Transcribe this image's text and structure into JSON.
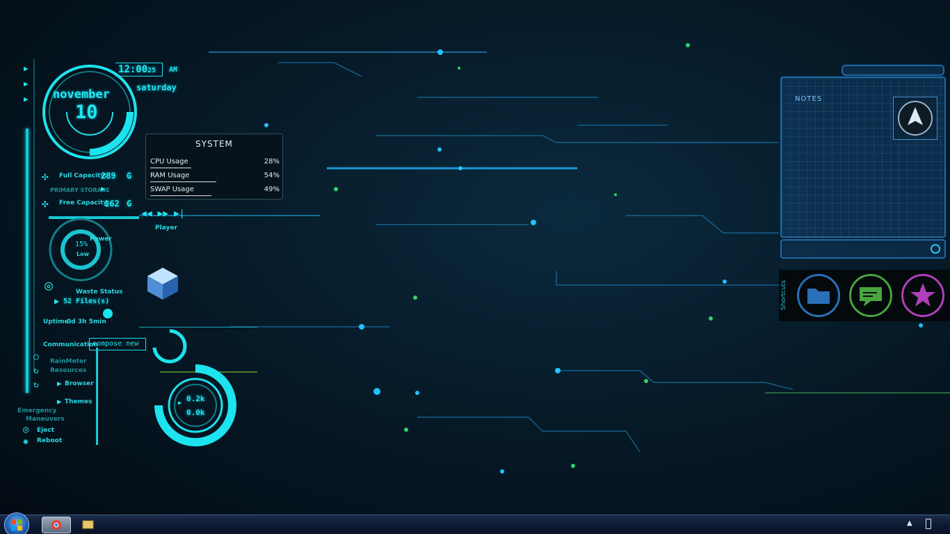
{
  "clock": {
    "time": "12:00",
    "seconds": "25",
    "ampm": "AM",
    "month": "november",
    "day": "10",
    "weekday": "saturday"
  },
  "storage": {
    "full_label": "Full Capacity:",
    "full_value": "289",
    "full_unit": "G",
    "primary_label": "PRIMARY STORAGE",
    "free_label": "Free Capacity:",
    "free_value": "162",
    "free_unit": "G"
  },
  "player": {
    "label": "Player"
  },
  "power": {
    "percent": "15%",
    "state": "Low",
    "label": "Power"
  },
  "waste": {
    "label": "Waste Status",
    "files": "52 Files(s)"
  },
  "uptime": {
    "label": "Uptime:",
    "value": "0d 3h 5min"
  },
  "communication": {
    "label": "Communication",
    "compose": "compose new"
  },
  "links": {
    "rainmeter": "RainMeter",
    "resources": "Resources",
    "browser": "Browser",
    "themes": "Themes"
  },
  "emergency": {
    "label1": "Emergency",
    "label2": "Maneuvers",
    "eject": "Eject",
    "reboot": "Reboot"
  },
  "network": {
    "up": "0.2k",
    "down": "0.0k"
  },
  "system": {
    "title": "SYSTEM",
    "rows": [
      {
        "label": "CPU Usage",
        "value": "28%",
        "fraction": 0.28
      },
      {
        "label": "RAM Usage",
        "value": "54%",
        "fraction": 0.54
      },
      {
        "label": "SWAP Usage",
        "value": "49%",
        "fraction": 0.49
      }
    ]
  },
  "notes": {
    "title": "NOTES"
  },
  "shortcuts": {
    "label": "Shortcuts",
    "icons": [
      "folder-icon",
      "chat-icon",
      "star-icon"
    ]
  },
  "colors": {
    "accent": "#22e6ef",
    "folder": "#2a6fb8",
    "chat": "#49a53f",
    "star": "#b03fb8"
  }
}
